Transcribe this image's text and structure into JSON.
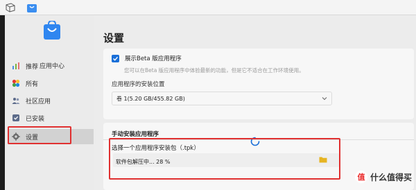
{
  "sidebar": {
    "app_name": "应用中心",
    "items": [
      {
        "label": "推荐",
        "icon": "bar-chart-icon"
      },
      {
        "label": "所有",
        "icon": "flower-icon"
      },
      {
        "label": "社区应用",
        "icon": "community-icon"
      },
      {
        "label": "已安装",
        "icon": "installed-icon"
      },
      {
        "label": "设置",
        "icon": "gear-icon"
      }
    ]
  },
  "main": {
    "title": "设置",
    "beta_label": "展示Beta 版应用程序",
    "beta_description": "您可以在Beta 版应用程序中体验最新的功能，但是它不适合在工作环境使用。",
    "install_location_label": "应用程序的安装位置",
    "install_location_value": "卷 1(5.20 GB/455.82 GB)",
    "manual_install_title": "手动安装应用程序",
    "choose_package_label": "选择一个应用程序安装包（.tpk）",
    "progress_text": "软件包解压中... 28 %",
    "progress": 0.28
  },
  "watermark": {
    "logo_char": "值",
    "text": "什么值得买"
  },
  "colors": {
    "accent": "#1a6fd8",
    "highlight": "#e03030"
  }
}
